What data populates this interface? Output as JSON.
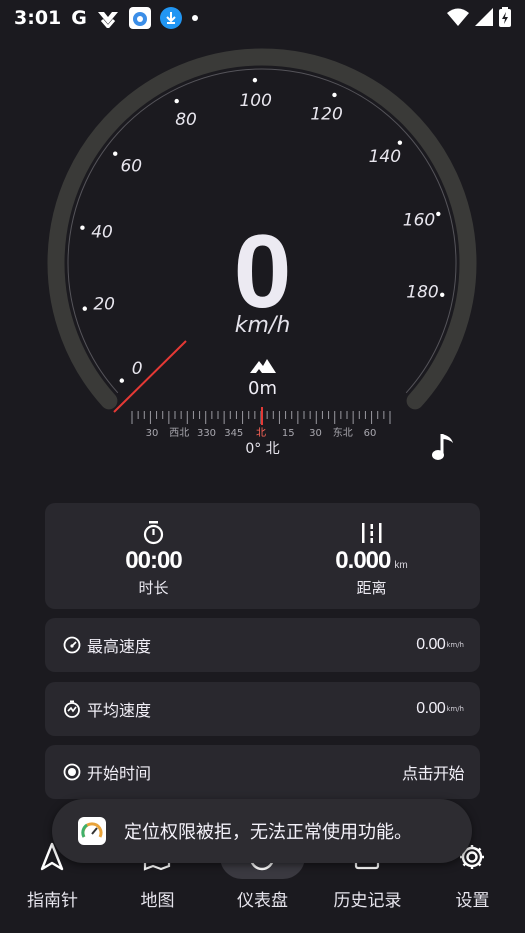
{
  "status_bar": {
    "time": "3:01",
    "google_letter": "G"
  },
  "gauge": {
    "ticks": [
      {
        "label": "0",
        "angle": 230
      },
      {
        "label": "20",
        "angle": 255.56
      },
      {
        "label": "40",
        "angle": 281.11
      },
      {
        "label": "60",
        "angle": 306.67
      },
      {
        "label": "80",
        "angle": 332.22
      },
      {
        "label": "100",
        "angle": 357.78
      },
      {
        "label": "120",
        "angle": 383.33
      },
      {
        "label": "140",
        "angle": 408.89
      },
      {
        "label": "160",
        "angle": 434.44
      },
      {
        "label": "180",
        "angle": 460
      }
    ],
    "speed": "0",
    "speed_unit": "km/h",
    "altitude": "0m",
    "heading": "0° 北",
    "compass_labels": [
      "30",
      "西北",
      "330",
      "345",
      "北",
      "15",
      "30",
      "东北",
      "60"
    ],
    "accent_color": "#e53935",
    "track_color": "#3a3a38"
  },
  "summary": {
    "duration_value": "00:00",
    "duration_label": "时长",
    "distance_value": "0.000",
    "distance_unit": "km",
    "distance_label": "距离"
  },
  "rows": {
    "max_speed_label": "最高速度",
    "max_speed_value": "0.00",
    "max_speed_unit": "km/h",
    "avg_speed_label": "平均速度",
    "avg_speed_value": "0.00",
    "avg_speed_unit": "km/h",
    "start_time_label": "开始时间",
    "start_time_value": "点击开始"
  },
  "toast": {
    "message": "定位权限被拒，无法正常使用功能。"
  },
  "nav": {
    "compass": "指南针",
    "map": "地图",
    "dashboard": "仪表盘",
    "history": "历史记录",
    "settings": "设置",
    "selected": "dashboard"
  }
}
